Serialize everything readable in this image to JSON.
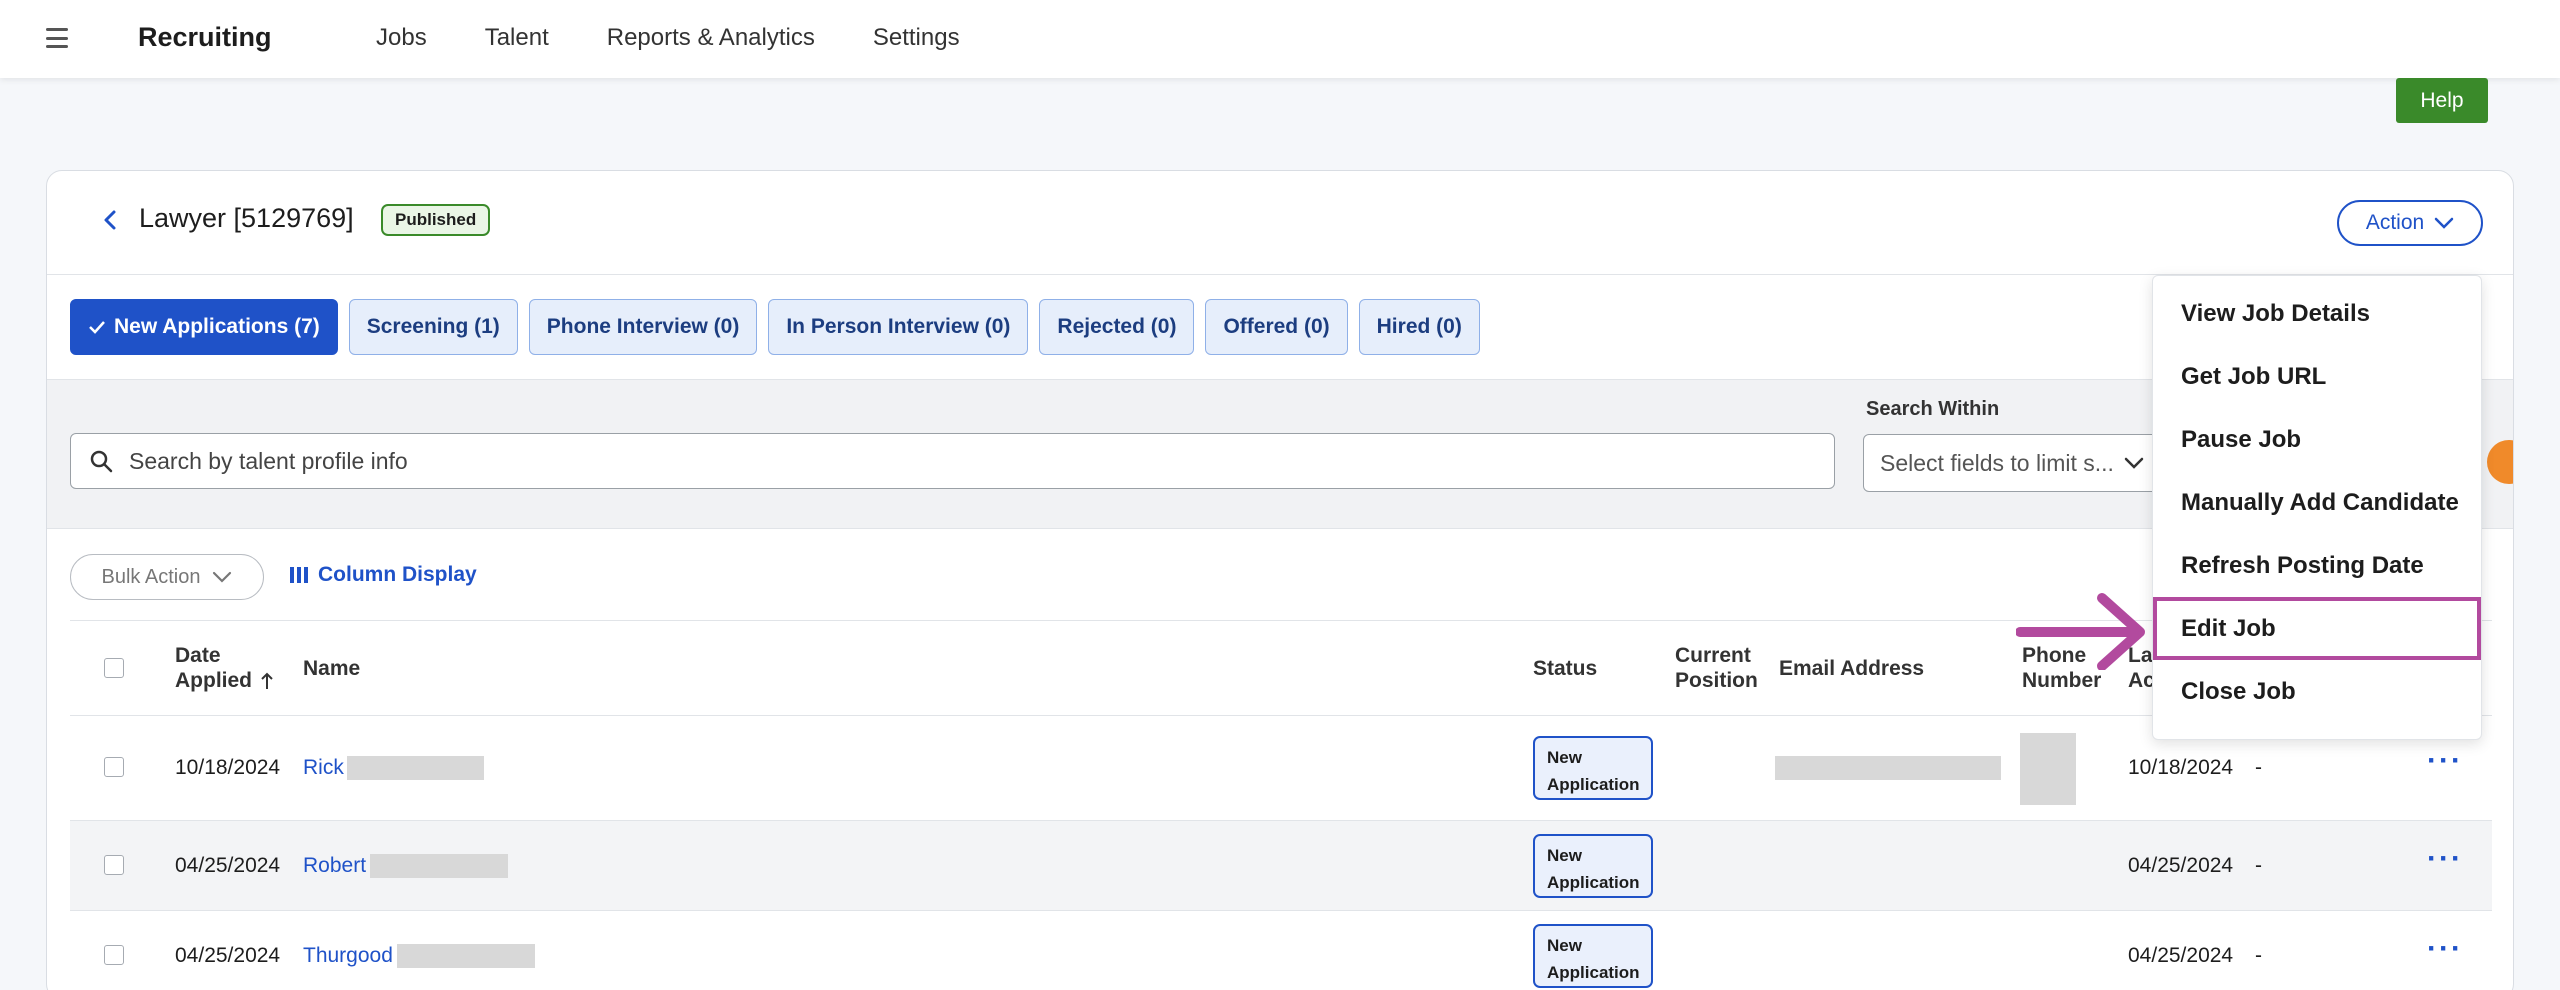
{
  "topbar": {
    "brand": "Recruiting",
    "nav": [
      "Jobs",
      "Talent",
      "Reports & Analytics",
      "Settings"
    ]
  },
  "help_label": "Help",
  "job": {
    "title": "Lawyer [5129769]",
    "status": "Published",
    "action_label": "Action"
  },
  "tabs": [
    {
      "label": "New Applications (7)",
      "active": true
    },
    {
      "label": "Screening (1)"
    },
    {
      "label": "Phone Interview (0)"
    },
    {
      "label": "In Person Interview (0)"
    },
    {
      "label": "Rejected (0)"
    },
    {
      "label": "Offered (0)"
    },
    {
      "label": "Hired (0)"
    }
  ],
  "search": {
    "placeholder": "Search by talent profile info",
    "within_label": "Search Within",
    "within_placeholder": "Select fields to limit s..."
  },
  "toolbar": {
    "bulk_action": "Bulk Action",
    "column_display": "Column Display"
  },
  "table": {
    "headers": {
      "date_applied_1": "Date",
      "date_applied_2": "Applied",
      "name": "Name",
      "status": "Status",
      "current_position_1": "Current",
      "current_position_2": "Position",
      "email": "Email Address",
      "phone_1": "Phone",
      "phone_2": "Number",
      "last_1": "La",
      "last_2": "Ac"
    },
    "rows": [
      {
        "date": "10/18/2024",
        "name": "Rick",
        "status_1": "New",
        "status_2": "Application",
        "last": "10/18/2024",
        "extra": "-"
      },
      {
        "date": "04/25/2024",
        "name": "Robert",
        "status_1": "New",
        "status_2": "Application",
        "last": "04/25/2024",
        "extra": "-"
      },
      {
        "date": "04/25/2024",
        "name": "Thurgood",
        "status_1": "New",
        "status_2": "Application",
        "last": "04/25/2024",
        "extra": "-"
      }
    ]
  },
  "action_menu": [
    "View Job Details",
    "Get Job URL",
    "Pause Job",
    "Manually Add Candidate",
    "Refresh Posting Date",
    "Edit Job",
    "Close Job"
  ],
  "colors": {
    "primary": "#1f52c8",
    "help_green": "#3a8a2a",
    "highlight": "#b24a9e"
  }
}
